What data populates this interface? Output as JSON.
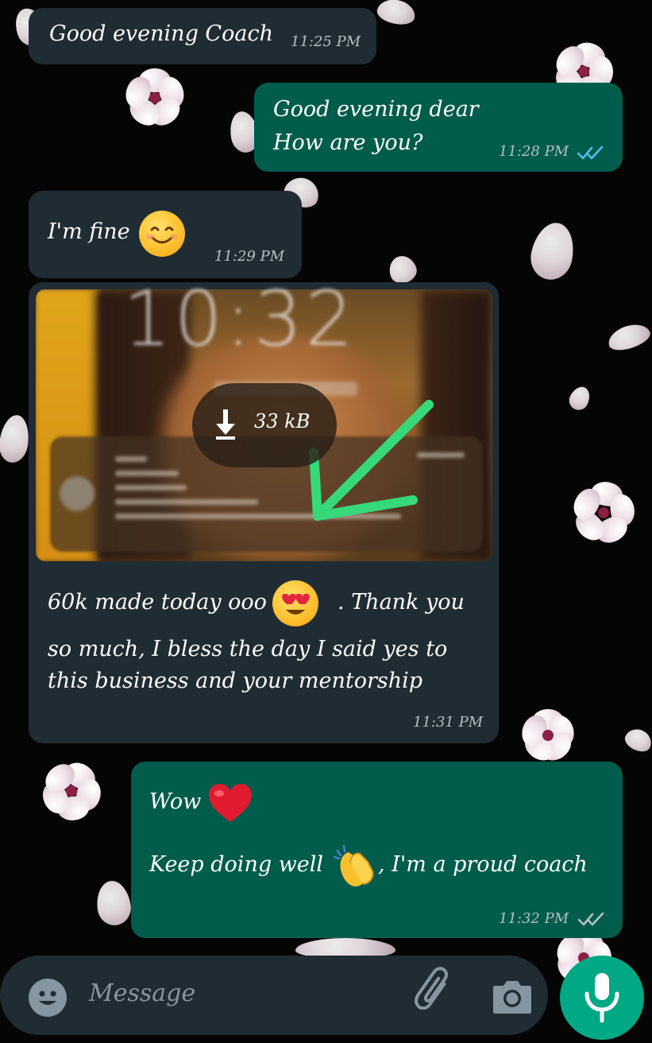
{
  "colors": {
    "incoming_bubble": "#202c33",
    "outgoing_bubble": "#005c4b",
    "mic_button": "#00a884",
    "read_tick": "#53bdeb",
    "sent_tick": "#b6c0c5"
  },
  "messages": [
    {
      "direction": "incoming",
      "text": "Good evening Coach",
      "time": "11:25 PM"
    },
    {
      "direction": "outgoing",
      "line1": "Good evening dear",
      "line2": "How are you?",
      "time": "11:28 PM",
      "status": "read"
    },
    {
      "direction": "incoming",
      "text": "I'm fine",
      "emoji": "smiling-face",
      "time": "11:29 PM"
    },
    {
      "direction": "incoming",
      "type": "image",
      "download_size": "33 kB",
      "caption_line1_a": "60k made today ooo",
      "caption_line1_b": ". Thank you",
      "caption_line2": "so much, I bless the day I said yes to",
      "caption_line3": "this business and your mentorship",
      "emoji": "heart-eyes",
      "time": "11:31 PM"
    },
    {
      "direction": "outgoing",
      "line1": "Wow",
      "line2_a": "Keep doing well",
      "line2_b": ", I'm a  proud coach",
      "emoji1": "red-heart",
      "emoji2": "clapping-hands",
      "time": "11:32 PM",
      "status": "delivered"
    }
  ],
  "composer": {
    "placeholder": "Message",
    "icons": [
      "emoji-icon",
      "attach-icon",
      "camera-icon",
      "mic-icon"
    ]
  }
}
